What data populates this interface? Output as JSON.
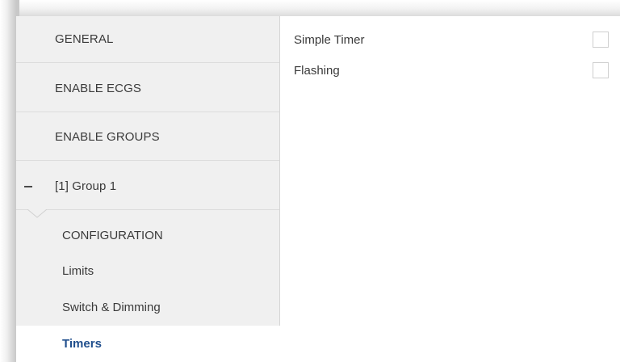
{
  "sidebar": {
    "items": [
      {
        "label": "GENERAL"
      },
      {
        "label": "ENABLE ECGS"
      },
      {
        "label": "ENABLE GROUPS"
      },
      {
        "label": "[1] Group 1"
      }
    ],
    "subitems": [
      {
        "label": "CONFIGURATION"
      },
      {
        "label": "Limits"
      },
      {
        "label": "Switch & Dimming"
      },
      {
        "label": "Timers",
        "selected": true
      }
    ]
  },
  "content": {
    "params": [
      {
        "label": "Simple Timer",
        "checked": false
      },
      {
        "label": "Flashing",
        "checked": false
      }
    ]
  },
  "colors": {
    "sidebar_bg": "#f0f0f0",
    "selected_text": "#1f4e8c",
    "text": "#3a3a3a"
  },
  "icons": {
    "group_toggle": "collapse-minus-icon",
    "selection_caret": "caret-down-icon"
  }
}
